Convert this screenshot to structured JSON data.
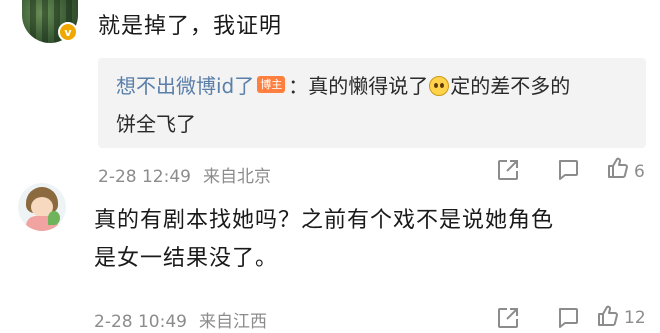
{
  "comment1": {
    "text": "就是掉了，我证明",
    "verified_badge": "v",
    "reply": {
      "author": "想不出微博id了",
      "badge": "博主",
      "separator": "：",
      "text_before_emoji": "真的懒得说了",
      "emoji": "grin-face-emoji",
      "text_after_emoji": "定的差不多的",
      "text_line2": "饼全飞了"
    },
    "time": "2-28 12:49",
    "location": "来自北京",
    "like_count": "6"
  },
  "comment2": {
    "line1": "真的有剧本找她吗？之前有个戏不是说她角色",
    "line2": "是女一结果没了。",
    "time": "2-28 10:49",
    "location": "来自江西",
    "like_count": "12"
  },
  "colors": {
    "reply_name": "#5a7fa8",
    "author_badge": "#ff7f3f",
    "meta": "#8c8c8c",
    "reply_bg": "#f3f3f3"
  }
}
